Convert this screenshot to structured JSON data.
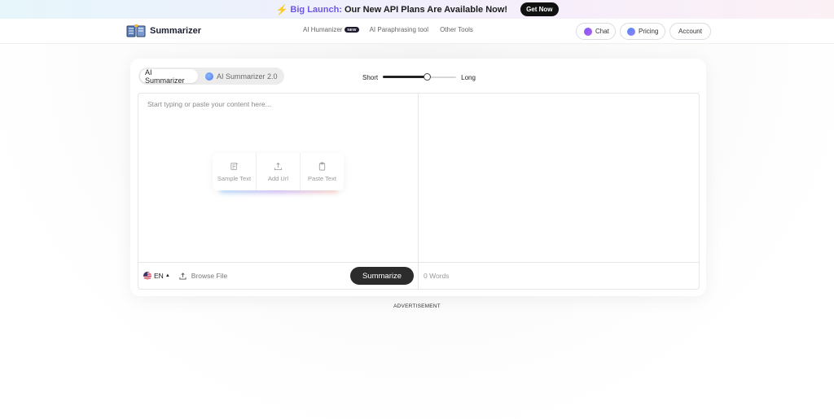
{
  "banner": {
    "bolt_icon": "lightning-bolt-icon",
    "highlight": "Big Launch:",
    "message": "Our New API Plans Are Available Now!",
    "cta": "Get Now",
    "colors": {
      "highlight": "#6f57e6",
      "bolt": "#f5a623"
    }
  },
  "header": {
    "logo_text": "Summarizer",
    "logo_icon": "open-book-icon",
    "nav": [
      {
        "label": "AI Humanizer",
        "badge": "NEW"
      },
      {
        "label": "AI Paraphrasing tool"
      },
      {
        "label": "Other Tools"
      }
    ],
    "buttons": {
      "chat": "Chat",
      "pricing": "Pricing",
      "account": "Account"
    }
  },
  "tool": {
    "modes": [
      "AI Summarizer",
      "AI Summarizer 2.0"
    ],
    "active_mode": "AI Summarizer",
    "length": {
      "short_label": "Short",
      "long_label": "Long",
      "value": 0.6
    },
    "input_placeholder": "Start typing or paste your content here...",
    "input_value": "",
    "quick_actions": [
      {
        "label": "Sample Text",
        "icon": "document-icon"
      },
      {
        "label": "Add Url",
        "icon": "upload-link-icon"
      },
      {
        "label": "Paste Text",
        "icon": "clipboard-icon"
      }
    ],
    "language": "EN",
    "language_flag": "us-flag-icon",
    "browse_label": "Browse File",
    "summarize_label": "Summarize",
    "word_count": "0 Words"
  },
  "ad_label": "ADVERTISEMENT"
}
